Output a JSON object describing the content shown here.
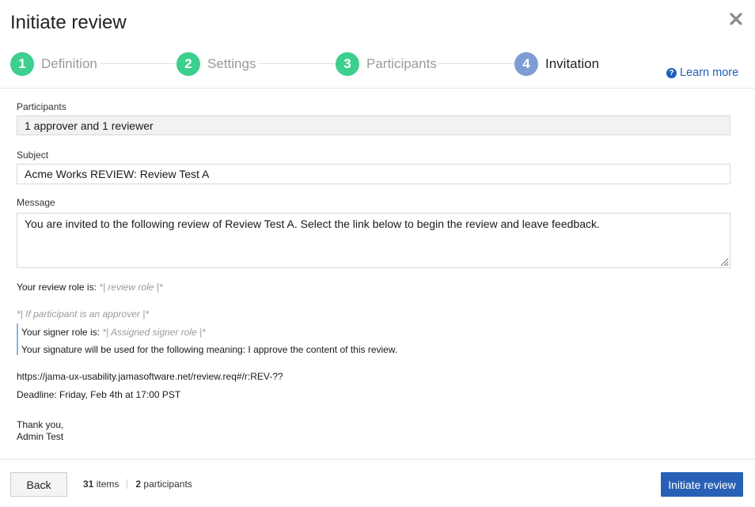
{
  "dialog": {
    "title": "Initiate review"
  },
  "steps": [
    {
      "number": "1",
      "label": "Definition",
      "color": "#3ccf8e"
    },
    {
      "number": "2",
      "label": "Settings",
      "color": "#3ccf8e"
    },
    {
      "number": "3",
      "label": "Participants",
      "color": "#3ccf8e"
    },
    {
      "number": "4",
      "label": "Invitation",
      "color": "#7f9bd3"
    }
  ],
  "learn_more": {
    "label": "Learn more"
  },
  "form": {
    "participants": {
      "label": "Participants",
      "value": "1 approver and 1 reviewer"
    },
    "subject": {
      "label": "Subject",
      "value": "Acme Works REVIEW: Review Test A"
    },
    "message": {
      "label": "Message",
      "value": "You are invited to the following review of Review Test A. Select the link below to begin the review and leave feedback."
    }
  },
  "preview": {
    "role_prefix": "Your review role is:",
    "role_placeholder": "*| review role |*",
    "approver_condition": "*| If participant is an approver |*",
    "signer_prefix": "Your signer role is:",
    "signer_placeholder": "*| Assigned signer role |*",
    "signature_meaning": "Your signature will be used for the following meaning: I approve the content of this review.",
    "link": "https://jama-ux-usability.jamasoftware.net/review.req#/r:REV-??",
    "deadline": "Deadline: Friday, Feb 4th at 17:00 PST",
    "thanks": "Thank you,",
    "sender": "Admin Test"
  },
  "footer": {
    "back_label": "Back",
    "items_count": "31",
    "items_label": "items",
    "participants_count": "2",
    "participants_label": "participants",
    "submit_label": "Initiate review"
  },
  "colors": {
    "accent": "#2860b6",
    "step_complete": "#3ccf8e",
    "step_current": "#7f9bd3"
  }
}
